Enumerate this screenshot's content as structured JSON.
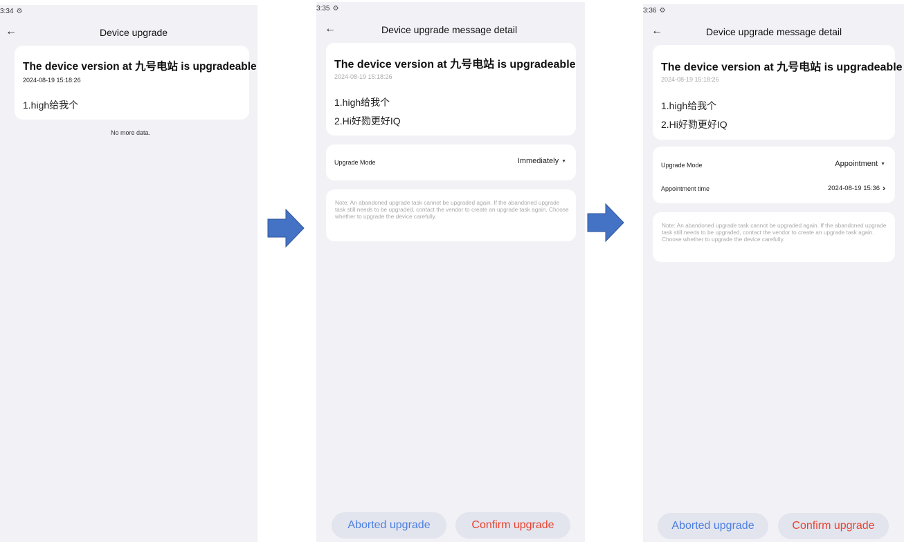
{
  "colors": {
    "arrow": "#4472c4",
    "accent_blue": "#4d7fe0",
    "accent_red": "#e8432e",
    "bg": "#f1f1f6"
  },
  "screen1": {
    "status_time": "3:34",
    "title": "Device upgrade",
    "card_title": "The device version at 九号电站 is upgradeable",
    "date": "2024-08-19 15:18:26",
    "items": [
      "1.high给我个"
    ],
    "footer": "No more data."
  },
  "screen2": {
    "status_time": "3:35",
    "title": "Device upgrade message detail",
    "card_title": "The device version at 九号电站 is upgradeable",
    "date": "2024-08-19 15:18:26",
    "items": [
      "1.high给我个",
      "2.Hi好勠更好IQ"
    ],
    "mode_label": "Upgrade Mode",
    "mode_value": "Immediately",
    "note": "Note: An abandoned upgrade task cannot be upgraded again. If the abandoned upgrade task still needs to be upgraded, contact the vendor to create an upgrade task again. Choose whether to upgrade the device carefully.",
    "abort_label": "Aborted upgrade",
    "confirm_label": "Confirm upgrade"
  },
  "screen3": {
    "status_time": "3:36",
    "title": "Device upgrade message detail",
    "card_title": "The device version at 九号电站 is upgradeable",
    "date": "2024-08-19 15:18:26",
    "items": [
      "1.high给我个",
      "2.Hi好勠更好IQ"
    ],
    "mode_label": "Upgrade Mode",
    "mode_value": "Appointment",
    "appt_label": "Appointment time",
    "appt_value": "2024-08-19 15:36",
    "note": "Note: An abandoned upgrade task cannot be upgraded again. If the abandoned upgrade task still needs to be upgraded, contact the vendor to create an upgrade task again. Choose whether to upgrade the device carefully.",
    "abort_label": "Aborted upgrade",
    "confirm_label": "Confirm upgrade"
  }
}
